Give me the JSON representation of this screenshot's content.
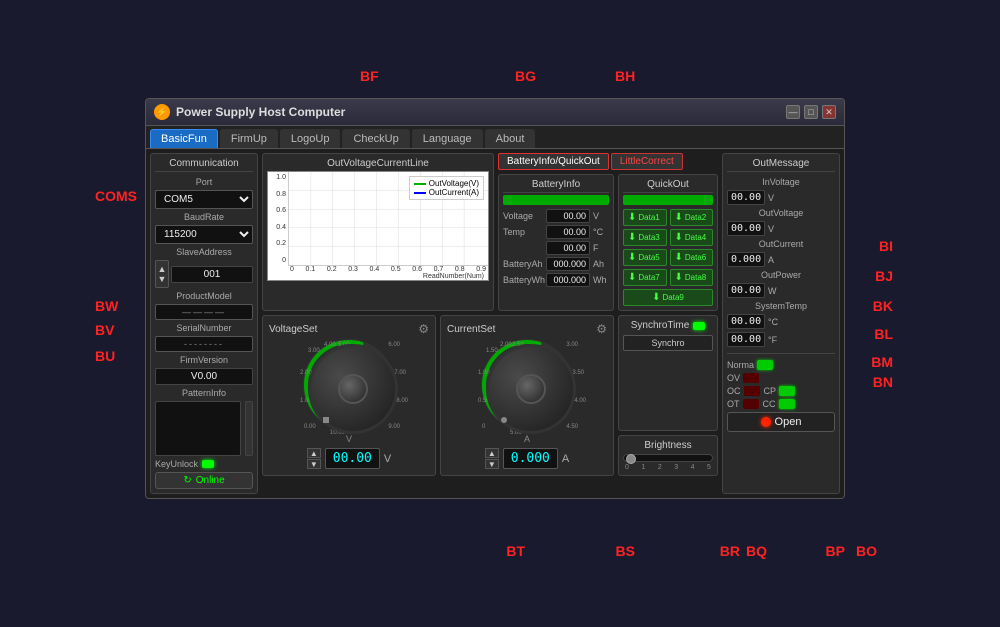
{
  "window": {
    "title": "Power Supply Host Computer",
    "title_icon": "⚡",
    "controls": [
      "—",
      "□",
      "✕"
    ]
  },
  "nav": {
    "tabs": [
      "BasicFun",
      "FirmUp",
      "LogoUp",
      "CheckUp",
      "Language",
      "About"
    ],
    "active": "BasicFun"
  },
  "communication": {
    "section_title": "Communication",
    "port_label": "Port",
    "port_value": "COM5",
    "baudrate_label": "BaudRate",
    "baudrate_value": "115200",
    "slave_address_label": "SlaveAddress",
    "slave_address_value": "001",
    "product_model_label": "ProductModel",
    "product_model_value": "————",
    "serial_number_label": "SerialNumber",
    "serial_number_value": "--------",
    "firm_version_label": "FirmVersion",
    "firm_version_value": "V0.00",
    "pattern_info_label": "PatternInfo",
    "key_unlock_label": "KeyUnlock",
    "online_btn": "Online"
  },
  "chart": {
    "title": "OutVoltageCurrentLine",
    "legend": {
      "voltage": "OutVoltage(V)",
      "current": "OutCurrent(A)"
    },
    "y_labels": [
      "1.0",
      "0.8",
      "0.6",
      "0.4",
      "0.2",
      "0"
    ],
    "x_labels": [
      "0",
      "0.1",
      "0.2",
      "0.3",
      "0.4",
      "0.5",
      "0.6",
      "0.7",
      "0.8",
      "0.9"
    ],
    "x_axis_label": "ReadNumber(Num)"
  },
  "battery_tab": "BatteryInfo/QuickOut",
  "little_correct_tab": "LittleCorrect",
  "battery_info": {
    "title": "BatteryInfo",
    "voltage_label": "Voltage",
    "voltage_value": "00.00",
    "voltage_unit": "V",
    "temp_label": "Temp",
    "temp_value": "00.00",
    "temp_unit": "°C",
    "temp2_value": "00.00",
    "temp2_unit": "F",
    "battery_ah_label": "BatteryAh",
    "battery_ah_value": "000.000",
    "battery_ah_unit": "Ah",
    "battery_wh_label": "BatteryWh",
    "battery_wh_value": "000.000",
    "battery_wh_unit": "Wh"
  },
  "quick_out": {
    "title": "QuickOut",
    "buttons": [
      "Data1",
      "Data2",
      "Data3",
      "Data4",
      "Data5",
      "Data6",
      "Data7",
      "Data8",
      "Data9"
    ]
  },
  "voltage_set": {
    "title": "VoltageSet",
    "value": "00.00",
    "unit": "V",
    "arc_labels": [
      "0.00",
      "1.00",
      "2.00",
      "3.00",
      "4.00",
      "5.00",
      "6.00",
      "7.00",
      "8.00",
      "9.00",
      "10.00"
    ]
  },
  "current_set": {
    "title": "CurrentSet",
    "value": "0.000",
    "unit": "A",
    "arc_labels": [
      "0",
      "0.50",
      "1.00",
      "1.50",
      "2.00",
      "2.50",
      "3.00",
      "3.50",
      "4.00",
      "4.50",
      "5.00"
    ]
  },
  "synchro_time": {
    "title": "SynchroTime",
    "synchro_btn": "Synchro"
  },
  "brightness": {
    "title": "Brightness",
    "labels": [
      "0",
      "1",
      "2",
      "3",
      "4",
      "5"
    ]
  },
  "out_message": {
    "title": "OutMessage",
    "in_voltage_label": "InVoltage",
    "in_voltage_value": "00.00",
    "in_voltage_unit": "V",
    "out_voltage_label": "OutVoltage",
    "out_voltage_value": "00.00",
    "out_voltage_unit": "V",
    "out_current_label": "OutCurrent",
    "out_current_value": "0.000",
    "out_current_unit": "A",
    "out_power_label": "OutPower",
    "out_power_value": "00.00",
    "out_power_unit": "W",
    "system_temp_label": "SystemTemp",
    "system_temp_c_value": "00.00",
    "system_temp_c_unit": "°C",
    "system_temp_f_value": "00.00",
    "system_temp_f_unit": "°F",
    "norma_label": "Norma",
    "ov_label": "OV",
    "oc_label": "OC",
    "cp_label": "CP",
    "ot_label": "OT",
    "cc_label": "CC",
    "open_btn": "Open"
  },
  "annotations": {
    "BF": "BF",
    "BG": "BG",
    "BH": "BH",
    "BI": "BI",
    "BJ": "BJ",
    "BK": "BK",
    "BL": "BL",
    "BM": "BM",
    "BN": "BN",
    "BO": "BO",
    "BP": "BP",
    "BQ": "BQ",
    "BR": "BR",
    "BS": "BS",
    "BT": "BT",
    "BU": "BU",
    "BV": "BV",
    "BW": "BW",
    "COMS": "COMS"
  }
}
